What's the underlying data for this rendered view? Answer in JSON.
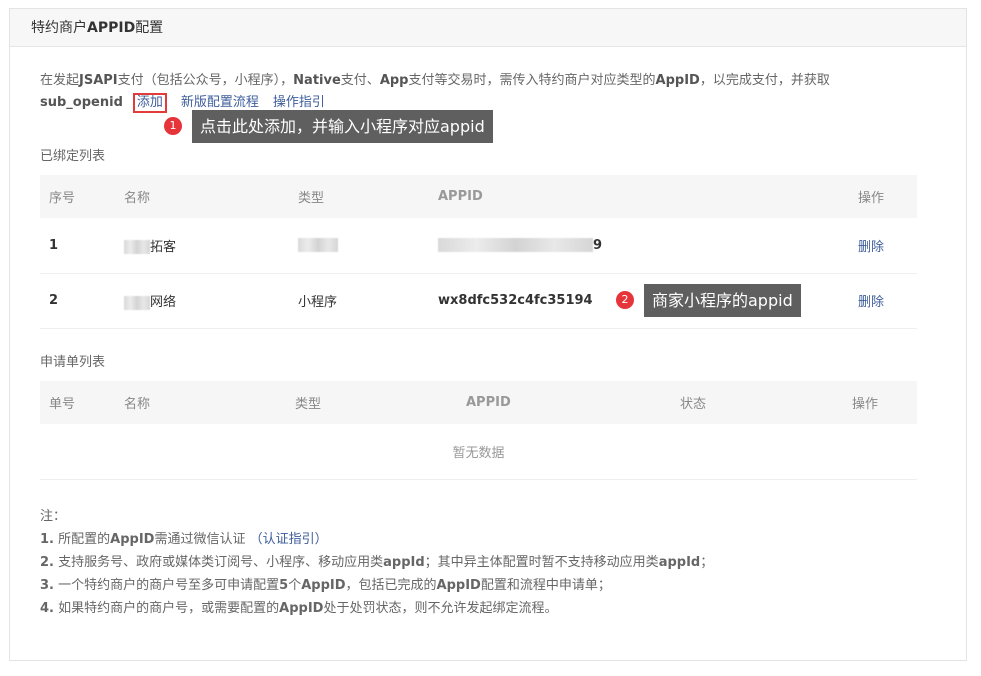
{
  "header": {
    "title_prefix": "特约商户",
    "title_bold": "APPID",
    "title_suffix": "配置"
  },
  "intro": {
    "p1": "在发起",
    "b1": "JSAPI",
    "p2": "支付（包括公众号，小程序），",
    "b2": "Native",
    "p3": "支付、",
    "b3": "App",
    "p4": "支付等交易时，需传入特约商户对应类型的",
    "b4": "AppID",
    "p5": "，以完成支付，并获取",
    "b5": "sub_openid",
    "add_link": "添加",
    "new_flow_link": "新版配置流程",
    "guide_link": "操作指引"
  },
  "annotations": {
    "badge1": "1",
    "tip1": "点击此处添加，并输入小程序对应appid",
    "badge2": "2",
    "tip2": "商家小程序的appid"
  },
  "bound_list": {
    "title": "已绑定列表",
    "headers": {
      "no": "序号",
      "name": "名称",
      "type": "类型",
      "appid": "APPID",
      "action": "操作"
    },
    "rows": [
      {
        "no": "1",
        "name": "拓客",
        "type": "",
        "appid": "9",
        "action": "删除"
      },
      {
        "no": "2",
        "name": "网络",
        "type": "小程序",
        "appid": "wx8dfc532c4fc35194",
        "action": "删除"
      }
    ]
  },
  "apply_list": {
    "title": "申请单列表",
    "headers": {
      "no": "单号",
      "name": "名称",
      "type": "类型",
      "appid": "APPID",
      "status": "状态",
      "action": "操作"
    },
    "empty_text": "暂无数据"
  },
  "notes": {
    "title": "注：",
    "n1_num": "1.",
    "n1_a": "所配置的",
    "n1_b": "AppID",
    "n1_c": "需通过微信认证",
    "n1_link": "（认证指引）",
    "n2_num": "2.",
    "n2_a": "支持服务号、政府或媒体类订阅号、小程序、移动应用类",
    "n2_b": "appId",
    "n2_c": "；其中异主体配置时暂不支持移动应用类",
    "n2_d": "appId",
    "n2_e": "；",
    "n3_num": "3.",
    "n3_a": "一个特约商户的商户号至多可申请配置",
    "n3_b": "5",
    "n3_c": "个",
    "n3_d": "AppID",
    "n3_e": "，包括已完成的",
    "n3_f": "AppID",
    "n3_g": "配置和流程中申请单；",
    "n4_num": "4.",
    "n4_a": "如果特约商户的商户号，或需要配置的",
    "n4_b": "AppID",
    "n4_c": "处于处罚状态，则不允许发起绑定流程。"
  },
  "colors": {
    "link": "#3e5d9b",
    "badge": "#e5343a",
    "tip_bg": "#5f5f5f",
    "highlight_border": "#e23b3b"
  }
}
